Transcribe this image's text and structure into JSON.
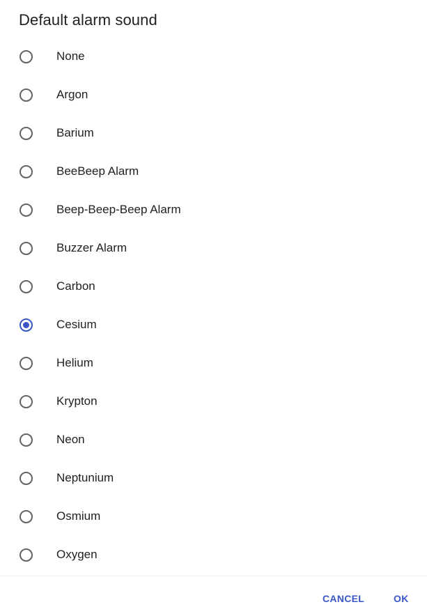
{
  "dialog": {
    "title": "Default alarm sound",
    "selected_index": 7,
    "options": [
      "None",
      "Argon",
      "Barium",
      "BeeBeep Alarm",
      "Beep-Beep-Beep Alarm",
      "Buzzer Alarm",
      "Carbon",
      "Cesium",
      "Helium",
      "Krypton",
      "Neon",
      "Neptunium",
      "Osmium",
      "Oxygen"
    ],
    "cancel_label": "CANCEL",
    "ok_label": "OK"
  },
  "colors": {
    "accent": "#3a56c5",
    "radio_unchecked": "#5f6368",
    "text": "#202124"
  }
}
